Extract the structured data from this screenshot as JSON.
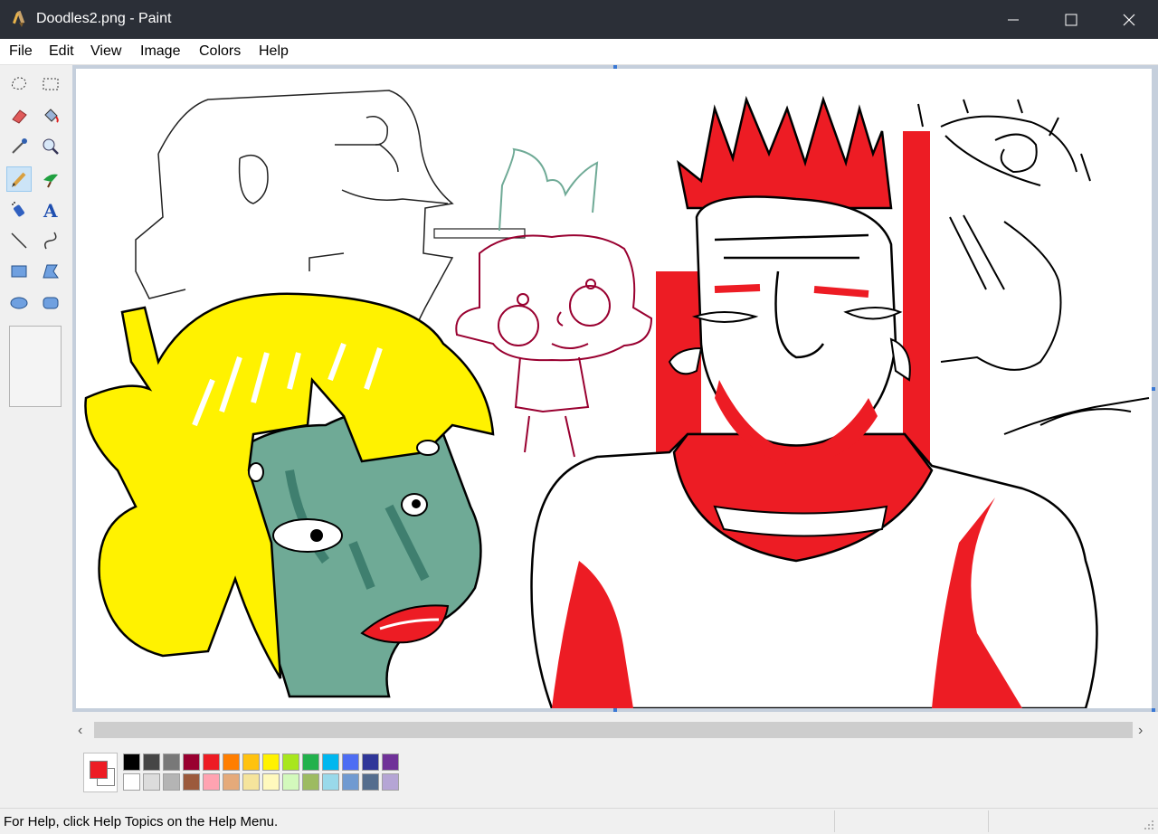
{
  "window": {
    "title": "Doodles2.png - Paint"
  },
  "menu": {
    "items": [
      "File",
      "Edit",
      "View",
      "Image",
      "Colors",
      "Help"
    ]
  },
  "tools": [
    {
      "name": "free-form-select-icon"
    },
    {
      "name": "rectangle-select-icon"
    },
    {
      "name": "eraser-icon"
    },
    {
      "name": "fill-bucket-icon"
    },
    {
      "name": "color-picker-icon"
    },
    {
      "name": "magnifier-icon"
    },
    {
      "name": "pencil-icon",
      "active": true
    },
    {
      "name": "brush-icon"
    },
    {
      "name": "airbrush-icon"
    },
    {
      "name": "text-icon"
    },
    {
      "name": "line-icon"
    },
    {
      "name": "curve-icon"
    },
    {
      "name": "rectangle-icon"
    },
    {
      "name": "polygon-icon"
    },
    {
      "name": "ellipse-icon"
    },
    {
      "name": "rounded-rectangle-icon"
    }
  ],
  "palette": {
    "foreground": "#ed1c24",
    "background": "#ffffff",
    "row1": [
      "#000000",
      "#464646",
      "#787878",
      "#990030",
      "#ed1c24",
      "#ff7e00",
      "#ffc20e",
      "#fff200",
      "#a8e61d",
      "#22b14c",
      "#00b7ef",
      "#4d6df3",
      "#2f3699",
      "#6f3198"
    ],
    "row2": [
      "#ffffff",
      "#dcdcdc",
      "#b4b4b4",
      "#9c5a3c",
      "#ffa3b1",
      "#e5aa7a",
      "#f5e49c",
      "#fff9bd",
      "#d3f9bc",
      "#9dbb61",
      "#99d9ea",
      "#709ad1",
      "#546d8e",
      "#b5a5d5"
    ]
  },
  "status": {
    "text": "For Help, click Help Topics on the Help Menu."
  },
  "colors": {
    "titlebar": "#2b2f37",
    "drawing_red": "#ed1c24",
    "drawing_yellow": "#fff200",
    "drawing_green": "#6faa96"
  }
}
